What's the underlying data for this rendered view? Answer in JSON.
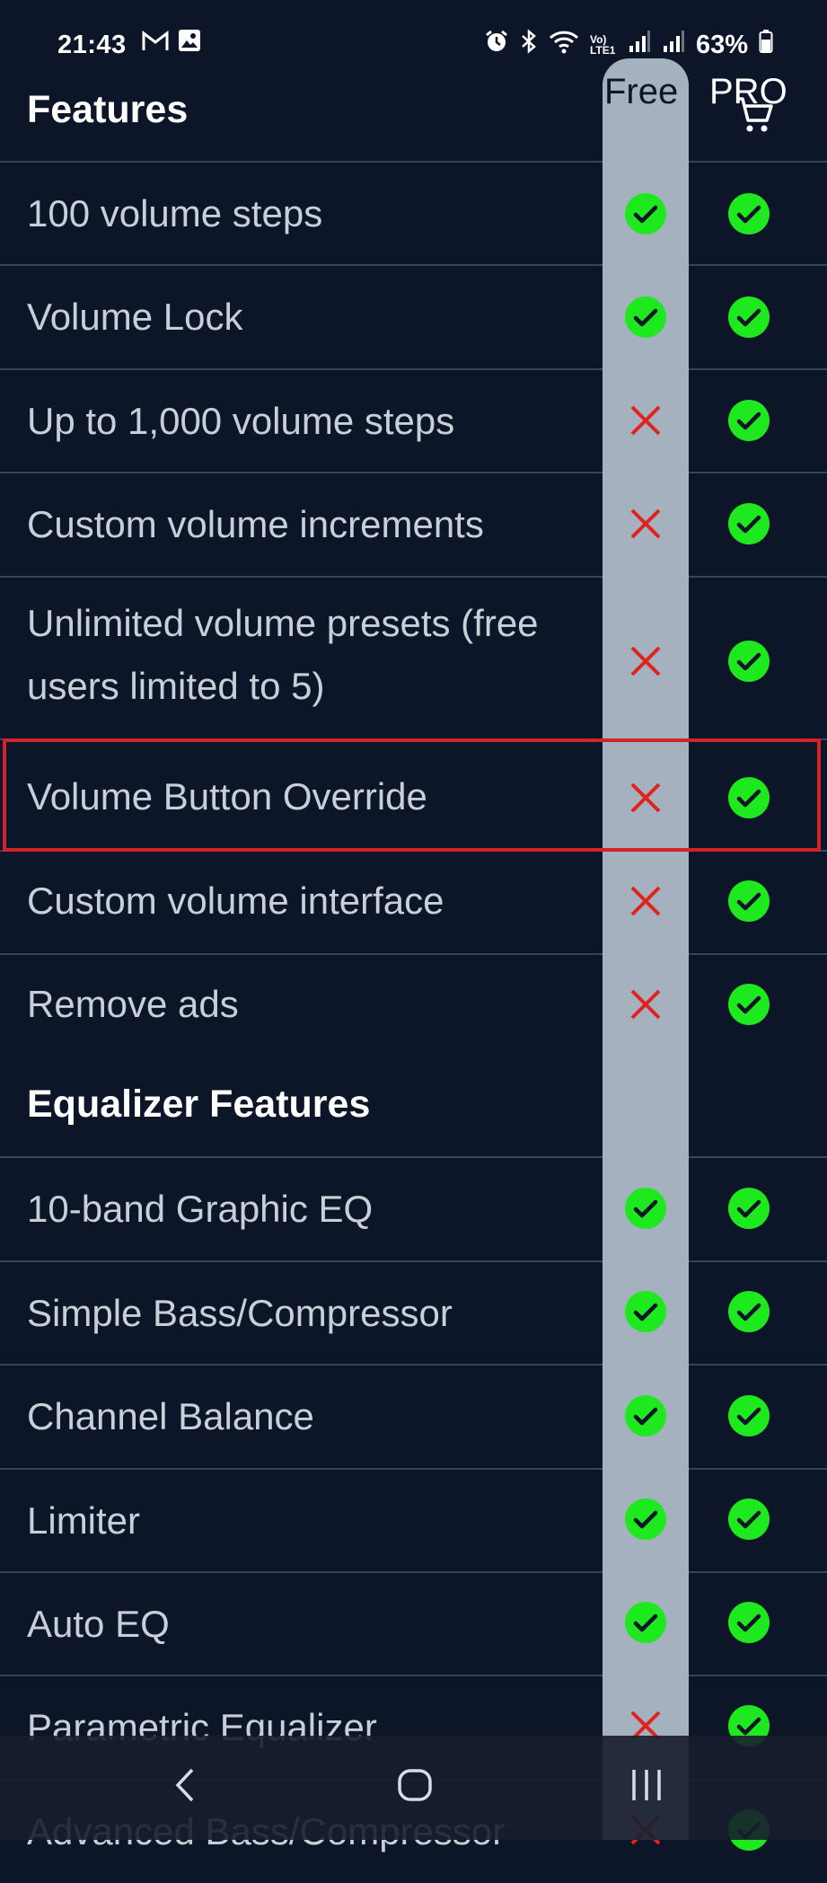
{
  "status_bar": {
    "time": "21:43",
    "left_icons": [
      "gmail-icon",
      "gallery-icon"
    ],
    "right_icons": [
      "alarm-icon",
      "bluetooth-icon",
      "wifi-icon",
      "volte-icon",
      "signal-icon",
      "signal-icon"
    ],
    "network_label": "Vo) LTE1",
    "battery": "63%"
  },
  "columns": {
    "free": "Free",
    "pro": "PRO"
  },
  "sections": [
    {
      "title": "Features",
      "rows": [
        {
          "label": "100 volume steps",
          "free": true,
          "pro": true
        },
        {
          "label": "Volume Lock",
          "free": true,
          "pro": true
        },
        {
          "label": "Up to 1,000 volume steps",
          "free": false,
          "pro": true
        },
        {
          "label": "Custom volume increments",
          "free": false,
          "pro": true
        },
        {
          "label": "Unlimited volume presets (free users limited to 5)",
          "free": false,
          "pro": true
        },
        {
          "label": "Volume Button Override",
          "free": false,
          "pro": true,
          "highlighted": true
        },
        {
          "label": "Custom volume interface",
          "free": false,
          "pro": true
        },
        {
          "label": "Remove ads",
          "free": false,
          "pro": true
        }
      ]
    },
    {
      "title": "Equalizer Features",
      "rows": [
        {
          "label": "10-band Graphic EQ",
          "free": true,
          "pro": true
        },
        {
          "label": "Simple Bass/Compressor",
          "free": true,
          "pro": true
        },
        {
          "label": "Channel Balance",
          "free": true,
          "pro": true
        },
        {
          "label": "Limiter",
          "free": true,
          "pro": true
        },
        {
          "label": "Auto EQ",
          "free": true,
          "pro": true
        },
        {
          "label": "Parametric Equalizer",
          "free": false,
          "pro": true
        },
        {
          "label": "Advanced Bass/Compressor",
          "free": false,
          "pro": true
        }
      ]
    }
  ],
  "colors": {
    "background": "#0d1628",
    "free_column": "#a6b1bf",
    "check_green": "#1ee81e",
    "cross_red": "#e0231c",
    "highlight_border": "#d2232a"
  },
  "navbar": [
    "back-icon",
    "home-icon",
    "recents-icon"
  ]
}
